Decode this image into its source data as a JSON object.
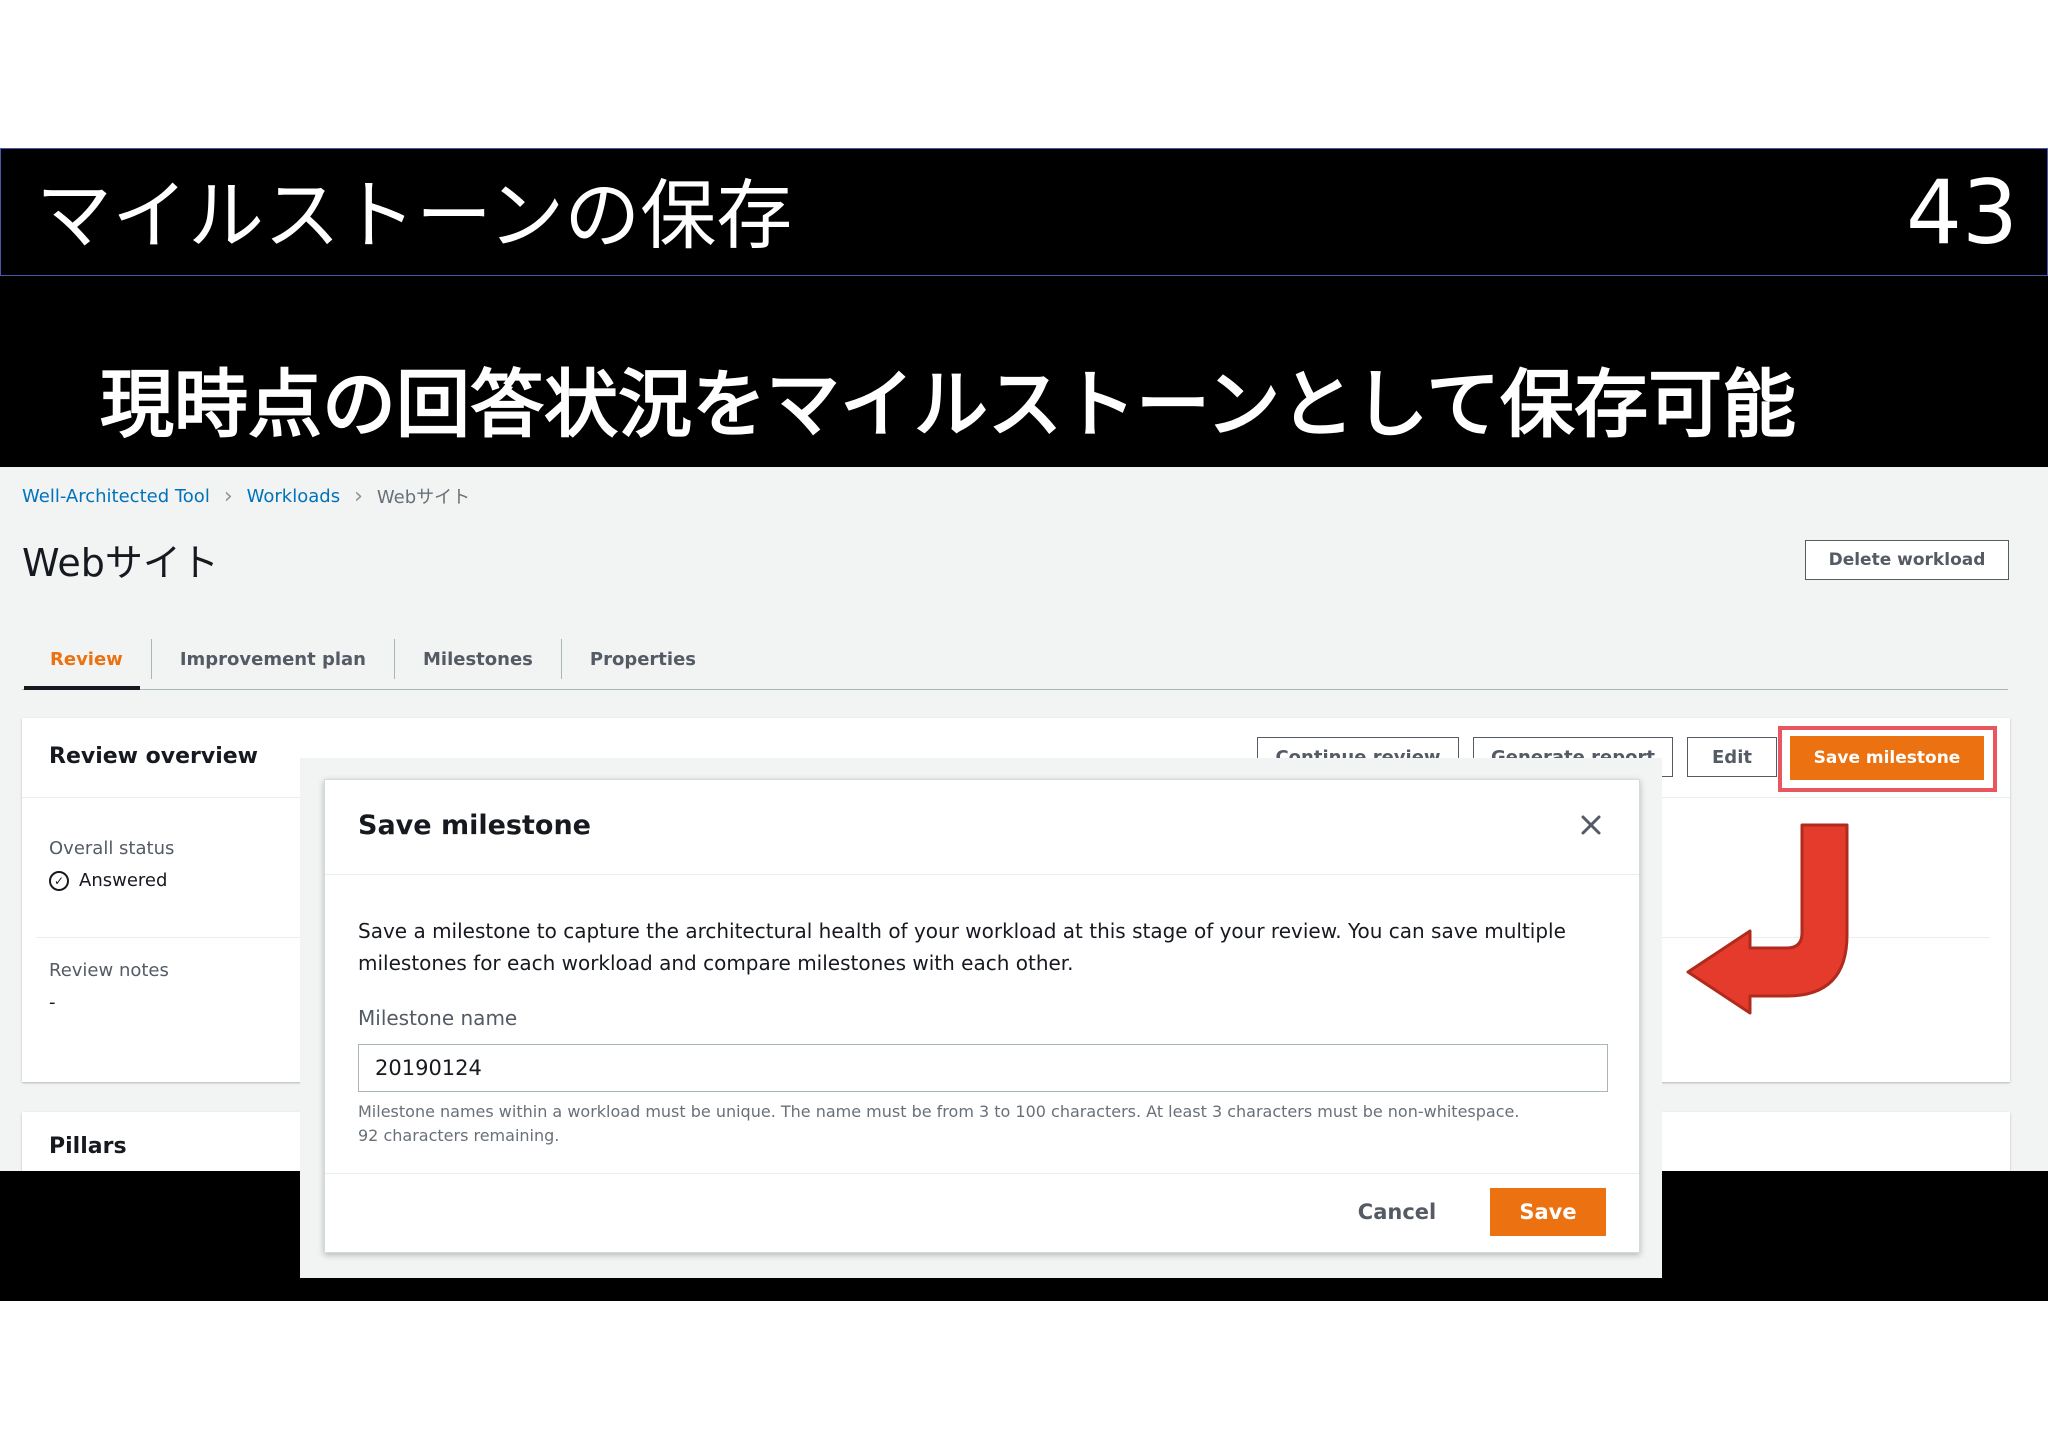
{
  "slide": {
    "title": "マイルストーンの保存",
    "number": "43",
    "subtitle": "現時点の回答状況をマイルストーンとして保存可能"
  },
  "breadcrumb": {
    "items": [
      "Well-Architected Tool",
      "Workloads",
      "Webサイト"
    ]
  },
  "page": {
    "title": "Webサイト",
    "delete_label": "Delete workload"
  },
  "tabs": [
    "Review",
    "Improvement plan",
    "Milestones",
    "Properties"
  ],
  "overview": {
    "title": "Review overview",
    "buttons": {
      "continue": "Continue review",
      "report": "Generate report",
      "edit": "Edit",
      "save_milestone": "Save milestone"
    },
    "overall_status_label": "Overall status",
    "overall_status_value": "Answered",
    "notes_label": "Review notes",
    "notes_value": "-"
  },
  "pillars": {
    "title": "Pillars"
  },
  "modal": {
    "title": "Save milestone",
    "description": "Save a milestone to capture the architectural health of your workload at this stage of your review. You can save multiple milestones for each workload and compare milestones with each other.",
    "field_label": "Milestone name",
    "field_value": "20190124",
    "hint": "Milestone names within a workload must be unique. The name must be from 3 to 100 characters. At least 3 characters must be non-whitespace. 92 characters remaining.",
    "cancel_label": "Cancel",
    "save_label": "Save"
  },
  "colors": {
    "accent": "#ec7211",
    "link": "#0073bb",
    "highlight": "#e8565f",
    "arrow": "#e53b2c"
  },
  "icons": [
    "chevron-right-icon",
    "check-circle-icon",
    "close-icon",
    "curved-arrow-icon"
  ]
}
